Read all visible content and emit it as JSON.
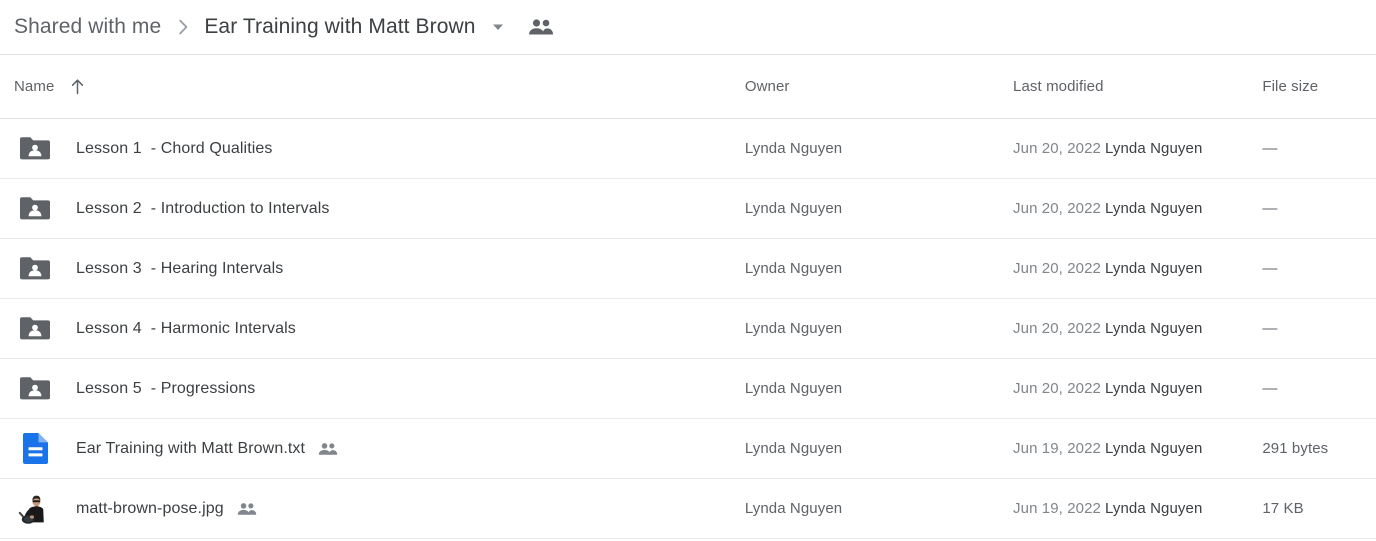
{
  "breadcrumb": {
    "root_label": "Shared with me",
    "separator": "›",
    "current_label": "Ear Training with Matt Brown",
    "caret_icon": "chevron-down-icon",
    "people_icon": "people-shared-icon"
  },
  "table": {
    "headers": {
      "name": "Name",
      "owner": "Owner",
      "last_modified": "Last modified",
      "file_size": "File size"
    },
    "sort": {
      "column": "Name",
      "direction": "ascending",
      "icon": "arrow-up-icon"
    },
    "rows": [
      {
        "icon": "shared-folder-icon",
        "name_lead": "Lesson 1",
        "name_rest": "- Chord Qualities",
        "shared_icon": "",
        "owner": "Lynda Nguyen",
        "modified_date": "Jun 20, 2022",
        "modified_by": "Lynda Nguyen",
        "size": "—"
      },
      {
        "icon": "shared-folder-icon",
        "name_lead": "Lesson 2",
        "name_rest": "- Introduction to Intervals",
        "shared_icon": "",
        "owner": "Lynda Nguyen",
        "modified_date": "Jun 20, 2022",
        "modified_by": "Lynda Nguyen",
        "size": "—"
      },
      {
        "icon": "shared-folder-icon",
        "name_lead": "Lesson 3",
        "name_rest": "- Hearing Intervals",
        "shared_icon": "",
        "owner": "Lynda Nguyen",
        "modified_date": "Jun 20, 2022",
        "modified_by": "Lynda Nguyen",
        "size": "—"
      },
      {
        "icon": "shared-folder-icon",
        "name_lead": "Lesson 4",
        "name_rest": "- Harmonic Intervals",
        "shared_icon": "",
        "owner": "Lynda Nguyen",
        "modified_date": "Jun 20, 2022",
        "modified_by": "Lynda Nguyen",
        "size": "—"
      },
      {
        "icon": "shared-folder-icon",
        "name_lead": "Lesson 5",
        "name_rest": "- Progressions",
        "shared_icon": "",
        "owner": "Lynda Nguyen",
        "modified_date": "Jun 20, 2022",
        "modified_by": "Lynda Nguyen",
        "size": "—"
      },
      {
        "icon": "text-document-icon",
        "name_lead": "",
        "name_rest": "Ear Training with Matt Brown.txt",
        "shared_icon": "people-shared-icon",
        "owner": "Lynda Nguyen",
        "modified_date": "Jun 19, 2022",
        "modified_by": "Lynda Nguyen",
        "size": "291 bytes"
      },
      {
        "icon": "image-thumbnail",
        "name_lead": "",
        "name_rest": "matt-brown-pose.jpg",
        "shared_icon": "people-shared-icon",
        "owner": "Lynda Nguyen",
        "modified_date": "Jun 19, 2022",
        "modified_by": "Lynda Nguyen",
        "size": "17 KB"
      }
    ]
  },
  "colors": {
    "folder_icon": "#5f6368",
    "doc_icon": "#1a73e8",
    "text_primary": "#3c4043",
    "text_secondary": "#5f6368",
    "text_muted": "#80868b",
    "divider": "#e8eaed"
  }
}
